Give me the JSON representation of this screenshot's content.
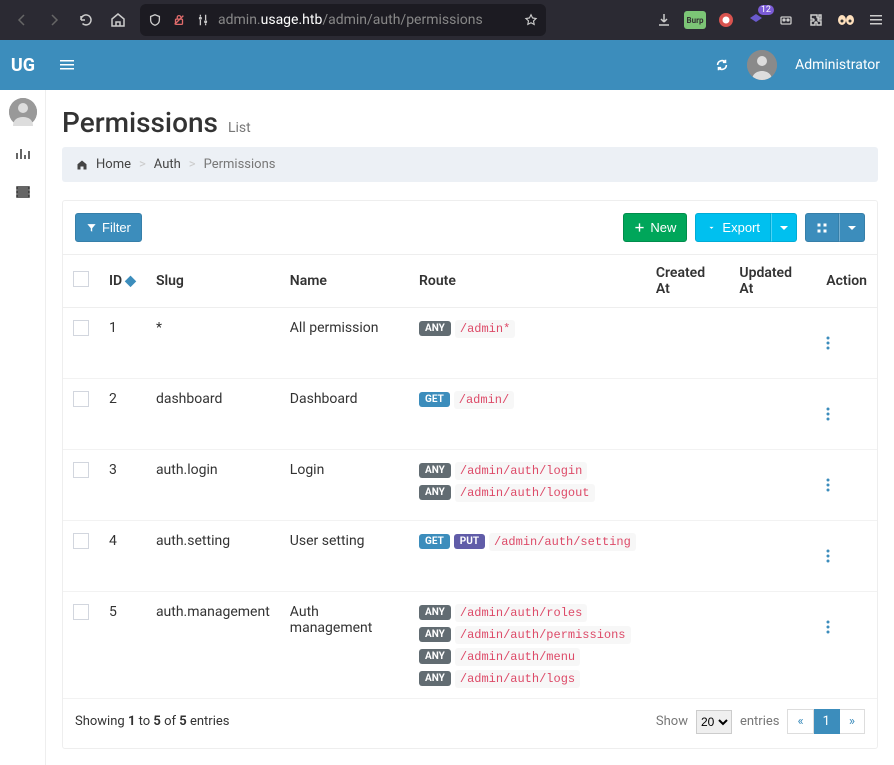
{
  "browser": {
    "url_prefix": "admin.",
    "url_host": "usage.htb",
    "url_path": "/admin/auth/permissions",
    "badge_count": "12"
  },
  "app": {
    "logo": "UG",
    "user_name": "Administrator"
  },
  "page": {
    "title": "Permissions",
    "subtitle": "List"
  },
  "breadcrumb": {
    "home": "Home",
    "auth": "Auth",
    "current": "Permissions"
  },
  "toolbar": {
    "filter": "Filter",
    "new": "New",
    "export": "Export"
  },
  "table": {
    "headers": {
      "id": "ID",
      "slug": "Slug",
      "name": "Name",
      "route": "Route",
      "created_at": "Created At",
      "updated_at": "Updated At",
      "action": "Action"
    },
    "rows": [
      {
        "id": "1",
        "slug": "*",
        "name": "All permission",
        "routes": [
          {
            "method": "ANY",
            "path": "/admin*"
          }
        ]
      },
      {
        "id": "2",
        "slug": "dashboard",
        "name": "Dashboard",
        "routes": [
          {
            "method": "GET",
            "path": "/admin/"
          }
        ]
      },
      {
        "id": "3",
        "slug": "auth.login",
        "name": "Login",
        "routes": [
          {
            "method": "ANY",
            "path": "/admin/auth/login"
          },
          {
            "method": "ANY",
            "path": "/admin/auth/logout"
          }
        ]
      },
      {
        "id": "4",
        "slug": "auth.setting",
        "name": "User setting",
        "routes": [
          {
            "method": "GET",
            "path": "/admin/auth/setting"
          },
          {
            "method": "PUT",
            "path": ""
          }
        ]
      },
      {
        "id": "5",
        "slug": "auth.management",
        "name": "Auth management",
        "routes": [
          {
            "method": "ANY",
            "path": "/admin/auth/roles"
          },
          {
            "method": "ANY",
            "path": "/admin/auth/permissions"
          },
          {
            "method": "ANY",
            "path": "/admin/auth/menu"
          },
          {
            "method": "ANY",
            "path": "/admin/auth/logs"
          }
        ]
      }
    ]
  },
  "footer": {
    "showing_pre": "Showing ",
    "from": "1",
    "to_word": " to ",
    "to": "5",
    "of_word": " of ",
    "total": "5",
    "entries_word": " entries",
    "show_label": "Show",
    "entries_label": "entries",
    "per_page": "20",
    "page_current": "1",
    "prev": "«",
    "next": "»"
  }
}
